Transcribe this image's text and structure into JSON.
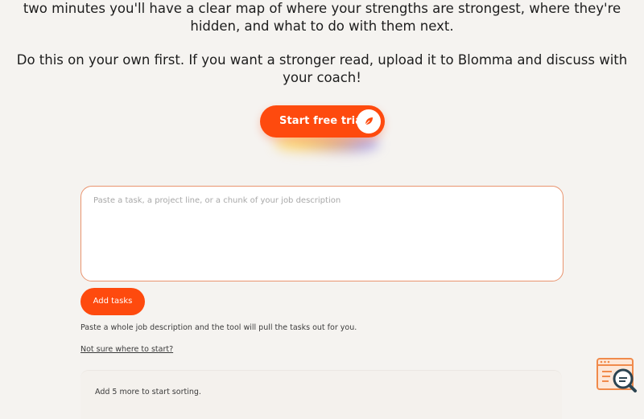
{
  "intro": {
    "line_top": "two minutes you'll have a clear map of where your strengths are strongest, where they're hidden, and what to do with them next.",
    "line_bottom": "Do this on your own first. If you want a stronger read, upload it to Blomma and discuss with your coach!"
  },
  "cta": {
    "label": "Start free trial",
    "icon": "leaf-icon"
  },
  "task_input": {
    "placeholder": "Paste a task, a project line, or a chunk of your job description",
    "value": ""
  },
  "add_button": {
    "label": "Add tasks"
  },
  "hint": "Paste a whole job description and the tool will pull the tasks out for you.",
  "help_link": "Not sure where to start?",
  "status": "Add 5 more to start sorting.",
  "floating_icon": "search-app-icon",
  "colors": {
    "accent": "#fe4a0e",
    "page_background": "#f5f3f0",
    "input_border": "#e9946f"
  }
}
